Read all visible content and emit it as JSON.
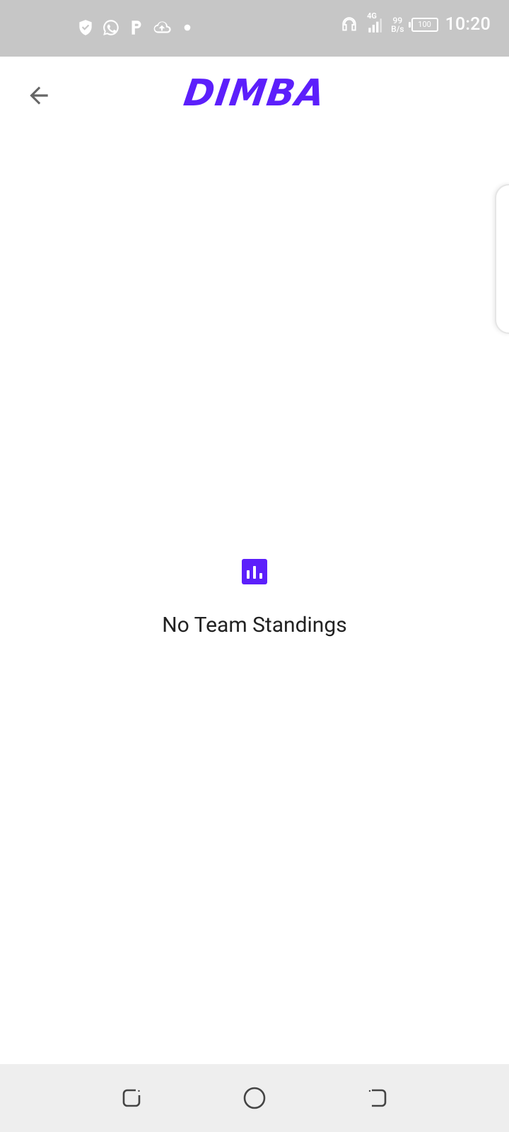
{
  "status_bar": {
    "left_icons": [
      "shield-check-icon",
      "whatsapp-icon",
      "p-app-icon",
      "cloud-upload-icon",
      "dot-icon"
    ],
    "network": "4G",
    "net_speed_value": "99",
    "net_speed_unit": "B/s",
    "battery": "100",
    "time": "10:20"
  },
  "app_bar": {
    "back_icon": "arrow-back-icon",
    "title": "DIMBA"
  },
  "empty_state": {
    "icon": "bar-chart-icon",
    "message": "No Team Standings"
  },
  "colors": {
    "accent": "#5c1ffb",
    "status_bar_bg": "#c6c6c6",
    "nav_bar_bg": "#eeeeee"
  },
  "nav_bar": {
    "buttons": [
      "recent-apps-icon",
      "home-icon",
      "back-icon"
    ]
  }
}
